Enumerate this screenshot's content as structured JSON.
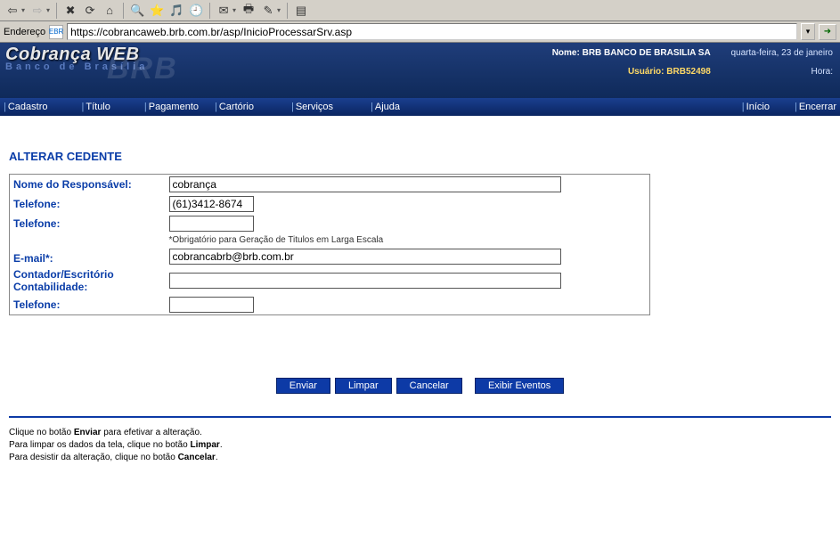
{
  "browser": {
    "address_label": "Endereço",
    "url": "https://cobrancaweb.brb.com.br/asp/InicioProcessarSrv.asp",
    "icon_label": "EBR"
  },
  "banner": {
    "title": "Cobrança WEB",
    "subtitle": "Banco de Brasília",
    "watermark": "BRB",
    "nome_label": "Nome:",
    "nome_value": "BRB BANCO DE BRASILIA SA",
    "date": "quarta-feira, 23 de janeiro",
    "usuario_label": "Usuário:",
    "usuario_value": "BRB52498",
    "hora_label": "Hora:"
  },
  "menu": {
    "items": [
      "Cadastro",
      "Título",
      "Pagamento",
      "Cartório",
      "Serviços",
      "Ajuda"
    ],
    "right_items": [
      "Início",
      "Encerrar"
    ]
  },
  "form": {
    "section_title": "ALTERAR CEDENTE",
    "rows": {
      "responsavel_label": "Nome do Responsável:",
      "responsavel_value": "cobrança",
      "telefone1_label": "Telefone:",
      "telefone1_value": "(61)3412-8674",
      "telefone2_label": "Telefone:",
      "telefone2_value": "",
      "email_hint": "*Obrigatório para Geração de Titulos em Larga Escala",
      "email_label": "E-mail*:",
      "email_value": "cobrancabrb@brb.com.br",
      "contador_label": "Contador/Escritório Contabilidade:",
      "contador_value": "",
      "telefone3_label": "Telefone:",
      "telefone3_value": ""
    }
  },
  "buttons": {
    "enviar": "Enviar",
    "limpar": "Limpar",
    "cancelar": "Cancelar",
    "exibir": "Exibir Eventos"
  },
  "instructions": {
    "line1_a": "Clique no botão ",
    "line1_b": "Enviar",
    "line1_c": " para efetivar a alteração.",
    "line2_a": "Para limpar os dados da tela, clique no botão ",
    "line2_b": "Limpar",
    "line2_c": ".",
    "line3_a": "Para desistir da alteração, clique no botão ",
    "line3_b": "Cancelar",
    "line3_c": "."
  }
}
